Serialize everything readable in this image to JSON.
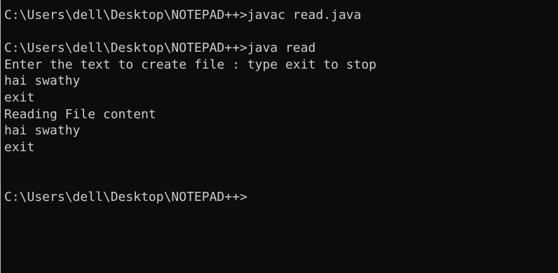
{
  "console": {
    "lines": [
      "C:\\Users\\dell\\Desktop\\NOTEPAD++>javac read.java",
      "",
      "C:\\Users\\dell\\Desktop\\NOTEPAD++>java read",
      "Enter the text to create file : type exit to stop",
      "hai swathy",
      "exit",
      "Reading File content",
      "hai swathy",
      "exit",
      "",
      "",
      "C:\\Users\\dell\\Desktop\\NOTEPAD++>"
    ]
  },
  "colors": {
    "background": "#0c0c0c",
    "foreground": "#cccccc"
  }
}
